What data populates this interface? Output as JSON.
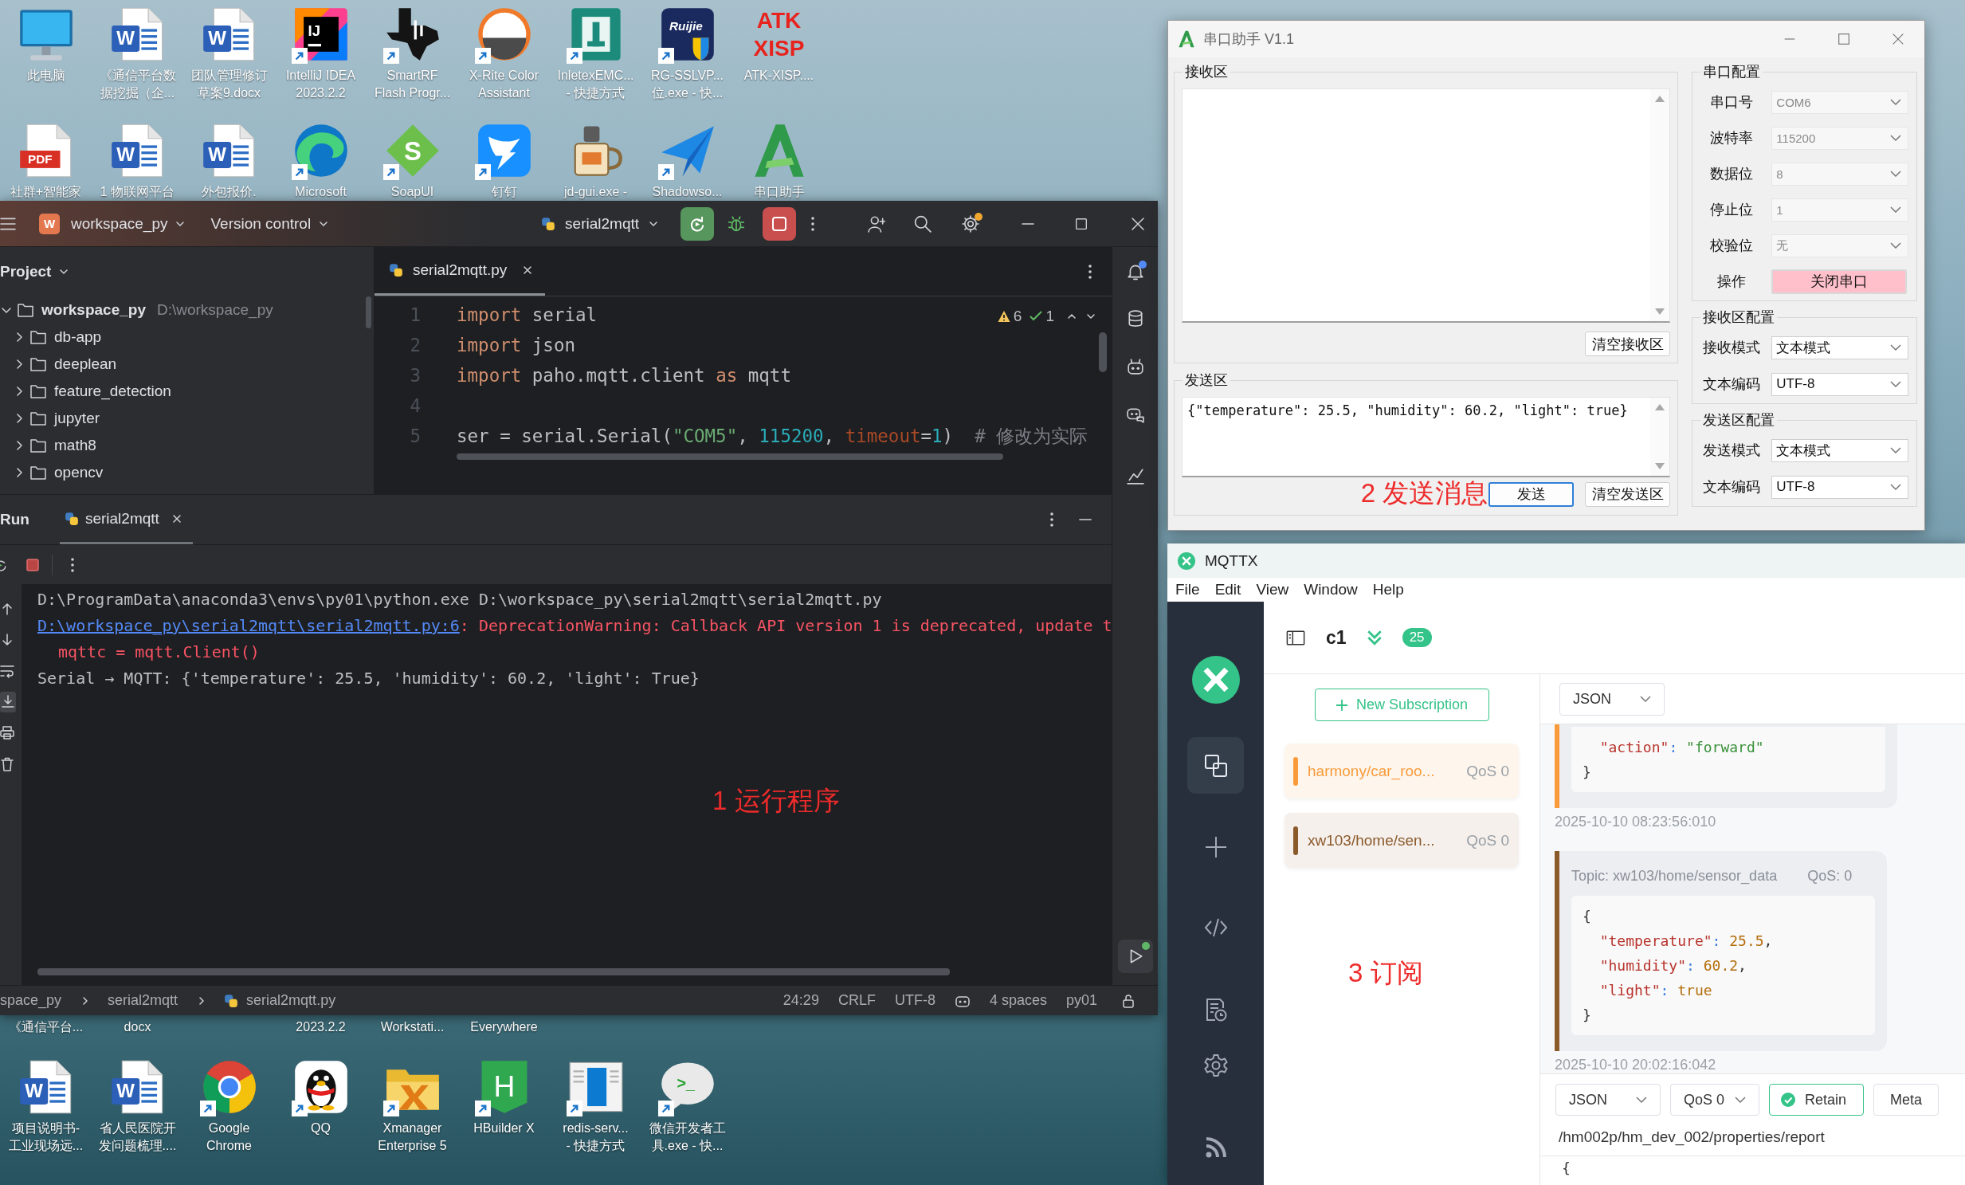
{
  "desktop": {
    "top_icons": [
      {
        "kind": "monitor",
        "label": "此电脑",
        "shortcut": false
      },
      {
        "kind": "word",
        "glyph": "W",
        "label": "《通信平台数据挖掘（企...",
        "shortcut": false
      },
      {
        "kind": "word",
        "glyph": "W",
        "label": "团队管理修订草案9.docx",
        "shortcut": false
      },
      {
        "kind": "intellij",
        "glyph": "IJ",
        "label": "IntelliJ IDEA\n2023.2.2",
        "shortcut": true
      },
      {
        "kind": "ti",
        "label": "SmartRF\nFlash Progr...",
        "shortcut": true
      },
      {
        "kind": "xrite",
        "label": "X-Rite Color\nAssistant",
        "shortcut": true
      },
      {
        "kind": "inletex",
        "label": "InletexEMC...\n- 快捷方式",
        "shortcut": true
      },
      {
        "kind": "ruijie",
        "glyph": "Ruijie",
        "label": "RG-SSLVP...\n位.exe - 快...",
        "shortcut": true
      },
      {
        "kind": "atk",
        "glyph": "ATK\nXISP",
        "label": "ATK-XISP....",
        "shortcut": false
      },
      {
        "kind": "pdf",
        "glyph": "PDF",
        "label": "社群+智能家",
        "shortcut": false
      },
      {
        "kind": "word",
        "glyph": "W",
        "label": "1 物联网平台",
        "shortcut": false
      },
      {
        "kind": "word",
        "glyph": "W",
        "label": "外包报价.",
        "shortcut": false
      },
      {
        "kind": "edge",
        "label": "Microsoft",
        "shortcut": true
      },
      {
        "kind": "soapui",
        "glyph": "S",
        "label": "SoapUI",
        "shortcut": true
      },
      {
        "kind": "dingtalk",
        "label": "钉钉",
        "shortcut": true
      },
      {
        "kind": "jdgui",
        "label": "jd-gui.exe -",
        "shortcut": false
      },
      {
        "kind": "shadowsocks",
        "label": "Shadowso...",
        "shortcut": true
      },
      {
        "kind": "serialtool",
        "label": "串口助手",
        "shortcut": false
      }
    ],
    "cut_labels": [
      "《通信平台...",
      "docx",
      "2023.2.2",
      "Workstati...",
      "Everywhere"
    ],
    "bottom_icons": [
      {
        "kind": "word",
        "glyph": "W",
        "label": "项目说明书-工业现场远...",
        "shortcut": false
      },
      {
        "kind": "word",
        "glyph": "W",
        "label": "省人民医院开发问题梳理....",
        "shortcut": false
      },
      {
        "kind": "chrome",
        "label": "Google\nChrome",
        "shortcut": true
      },
      {
        "kind": "qq",
        "label": "QQ",
        "shortcut": true
      },
      {
        "kind": "xmanager",
        "label": "Xmanager\nEnterprise 5",
        "shortcut": true
      },
      {
        "kind": "hbuilder",
        "glyph": "H",
        "label": "HBuilder X",
        "shortcut": true
      },
      {
        "kind": "redis",
        "label": "redis-serv...\n- 快捷方式",
        "shortcut": true
      },
      {
        "kind": "wechatdev",
        "glyph": ">_",
        "label": "微信开发者工具.exe - 快...",
        "shortcut": true
      }
    ]
  },
  "pycharm": {
    "project_badge": "W",
    "project": "workspace_py",
    "vcs": "Version control",
    "run_config": "serial2mqtt",
    "running": true,
    "settings_update": true,
    "notifications_unread": true,
    "project_panel": {
      "title": "Project",
      "tree": [
        {
          "name": "workspace_py",
          "path": "D:\\workspace_py",
          "expanded": true,
          "children": [
            {
              "name": "db-app",
              "expanded": false
            },
            {
              "name": "deeplean",
              "expanded": false
            },
            {
              "name": "feature_detection",
              "expanded": false
            },
            {
              "name": "jupyter",
              "expanded": false
            },
            {
              "name": "math8",
              "expanded": false
            },
            {
              "name": "opencv",
              "expanded": false
            }
          ]
        }
      ]
    },
    "editor": {
      "tabs": [
        {
          "label": "serial2mqtt.py",
          "selected": true
        }
      ],
      "warnings": "6",
      "checks": "1",
      "lines": [
        {
          "number": "1",
          "tokens": [
            {
              "text": "import",
              "kind": "keyword"
            },
            {
              "text": " serial",
              "kind": "plain"
            }
          ]
        },
        {
          "number": "2",
          "tokens": [
            {
              "text": "import",
              "kind": "keyword"
            },
            {
              "text": " json",
              "kind": "plain"
            }
          ]
        },
        {
          "number": "3",
          "tokens": [
            {
              "text": "import",
              "kind": "keyword"
            },
            {
              "text": " paho.mqtt.client ",
              "kind": "plain"
            },
            {
              "text": "as",
              "kind": "keyword"
            },
            {
              "text": " mqtt",
              "kind": "plain"
            }
          ]
        },
        {
          "number": "4"
        },
        {
          "number": "5",
          "tokens": [
            {
              "text": "ser = serial.Serial(",
              "kind": "plain"
            },
            {
              "text": "\"COM5\"",
              "kind": "string"
            },
            {
              "text": ", ",
              "kind": "plain"
            },
            {
              "text": "115200",
              "kind": "number"
            },
            {
              "text": ", ",
              "kind": "plain"
            },
            {
              "text": "timeout",
              "kind": "param"
            },
            {
              "text": "=",
              "kind": "plain"
            },
            {
              "text": "1",
              "kind": "number"
            },
            {
              "text": ")  ",
              "kind": "plain"
            },
            {
              "text": "# 修改为实际",
              "kind": "comment"
            }
          ]
        }
      ]
    },
    "run_panel": {
      "title": "Run",
      "tabs": [
        {
          "label": "serial2mqtt",
          "selected": true
        }
      ],
      "console": [
        {
          "kind": "plain",
          "text": "D:\\ProgramData\\anaconda3\\envs\\py01\\python.exe D:\\workspace_py\\serial2mqtt\\serial2mqtt.py"
        },
        {
          "kind": "warning",
          "link": "D:\\workspace_py\\serial2mqtt\\serial2mqtt.py:6",
          "text": ": DeprecationWarning: Callback API version 1 is deprecated, update t"
        },
        {
          "kind": "error",
          "text": "mqttc = mqtt.Client()"
        },
        {
          "kind": "plain",
          "text": "Serial → MQTT: {'temperature': 25.5, 'humidity': 60.2, 'light': True}"
        }
      ],
      "annotation": "1 运行程序"
    },
    "status_bar": {
      "breadcrumbs": [
        {
          "label": "space_py",
          "kind": "folder"
        },
        {
          "label": "serial2mqtt",
          "kind": "folder"
        },
        {
          "label": "serial2mqtt.py",
          "kind": "python"
        }
      ],
      "position": "24:29",
      "line_ending": "CRLF",
      "encoding": "UTF-8",
      "indent": "4 spaces",
      "interpreter": "py01"
    }
  },
  "serial_tool": {
    "title": "串口助手 V1.1",
    "receive": {
      "title": "接收区",
      "clear_button": "清空接收区"
    },
    "send": {
      "title": "发送区",
      "text": "{\"temperature\": 25.5, \"humidity\": 60.2, \"light\": true}",
      "send_button": "发送",
      "send_focused": true,
      "clear_button": "清空发送区",
      "annotation": "2 发送消息"
    },
    "port_config": {
      "title": "串口配置",
      "fields": [
        {
          "label": "串口号",
          "value": "COM6",
          "disabled": true
        },
        {
          "label": "波特率",
          "value": "115200",
          "disabled": true
        },
        {
          "label": "数据位",
          "value": "8",
          "disabled": true
        },
        {
          "label": "停止位",
          "value": "1",
          "disabled": true
        },
        {
          "label": "校验位",
          "value": "无",
          "disabled": true
        }
      ],
      "action_label": "操作",
      "action_button": "关闭串口"
    },
    "receive_config": {
      "title": "接收区配置",
      "fields": [
        {
          "label": "接收模式",
          "value": "文本模式",
          "disabled": false
        },
        {
          "label": "文本编码",
          "value": "UTF-8",
          "disabled": false
        }
      ]
    },
    "send_config": {
      "title": "发送区配置",
      "fields": [
        {
          "label": "发送模式",
          "value": "文本模式",
          "disabled": false
        },
        {
          "label": "文本编码",
          "value": "UTF-8",
          "disabled": false
        }
      ]
    }
  },
  "mqttx": {
    "title": "MQTTX",
    "menu": [
      "File",
      "Edit",
      "View",
      "Window",
      "Help"
    ],
    "connection": "c1",
    "message_count": "25",
    "new_subscription": "New Subscription",
    "subscriptions": [
      {
        "topic": "harmony/car_roo...",
        "qos": "QoS 0",
        "color": "#f99b3b"
      },
      {
        "topic": "xw103/home/sen...",
        "qos": "QoS 0",
        "color": "#8b5a2b"
      }
    ],
    "annotation": "3 订阅",
    "payload_format": "JSON",
    "messages": [
      {
        "color": "#f99b3b",
        "lines": [
          {
            "tokens": [
              {
                "text": "  \"action\"",
                "kind": "key"
              },
              {
                "text": ": ",
                "kind": "punct"
              },
              {
                "text": "\"forward\"",
                "kind": "string"
              }
            ]
          },
          {
            "tokens": [
              {
                "text": "}",
                "kind": "brace"
              }
            ]
          }
        ],
        "time": "2025-10-10 08:23:56:010"
      },
      {
        "color": "#8b5a2b",
        "topic": "Topic: xw103/home/sensor_data",
        "qos": "QoS: 0",
        "lines": [
          {
            "tokens": [
              {
                "text": "{",
                "kind": "brace"
              }
            ]
          },
          {
            "tokens": [
              {
                "text": "  \"temperature\"",
                "kind": "key"
              },
              {
                "text": ": ",
                "kind": "punct"
              },
              {
                "text": "25.5",
                "kind": "number"
              },
              {
                "text": ",",
                "kind": "brace"
              }
            ]
          },
          {
            "tokens": [
              {
                "text": "  \"humidity\"",
                "kind": "key"
              },
              {
                "text": ": ",
                "kind": "punct"
              },
              {
                "text": "60.2",
                "kind": "number"
              },
              {
                "text": ",",
                "kind": "brace"
              }
            ]
          },
          {
            "tokens": [
              {
                "text": "  \"light\"",
                "kind": "key"
              },
              {
                "text": ": ",
                "kind": "punct"
              },
              {
                "text": "true",
                "kind": "bool"
              }
            ]
          },
          {
            "tokens": [
              {
                "text": "}",
                "kind": "brace"
              }
            ]
          }
        ],
        "time": "2025-10-10 20:02:16:042"
      }
    ],
    "composer": {
      "format": "JSON",
      "qos": "QoS 0",
      "retain_label": "Retain",
      "retain": true,
      "meta": "Meta",
      "topic": "/hm002p/hm_dev_002/properties/report",
      "payload": "{"
    }
  }
}
